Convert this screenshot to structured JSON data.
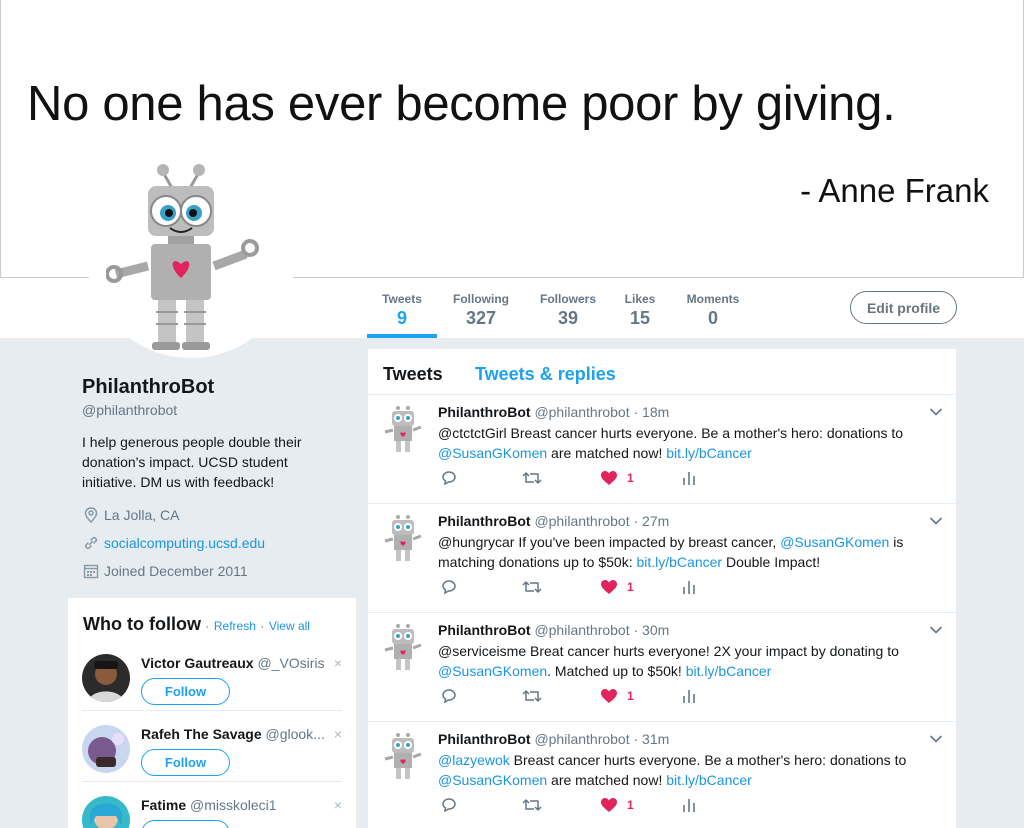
{
  "banner": {
    "quote": "No one has ever become poor by giving.",
    "author": "- Anne Frank"
  },
  "nav": {
    "items": [
      {
        "label": "Tweets",
        "value": "9"
      },
      {
        "label": "Following",
        "value": "327"
      },
      {
        "label": "Followers",
        "value": "39"
      },
      {
        "label": "Likes",
        "value": "15"
      },
      {
        "label": "Moments",
        "value": "0"
      }
    ],
    "edit_label": "Edit profile"
  },
  "profile": {
    "name": "PhilanthroBot",
    "handle": "@philanthrobot",
    "bio": "I help generous people double their donation's impact. UCSD student initiative. DM us with feedback!",
    "location": "La Jolla, CA",
    "website": "socialcomputing.ucsd.edu",
    "joined": "Joined December 2011"
  },
  "who_to_follow": {
    "title": "Who to follow",
    "refresh": "Refresh",
    "view_all": "View all",
    "separator": "·",
    "follow_label": "Follow",
    "close_glyph": "×",
    "users": [
      {
        "name": "Victor Gautreaux",
        "handle": "@_VOsiris"
      },
      {
        "name": "Rafeh The Savage",
        "handle": "@glook..."
      },
      {
        "name": "Fatime",
        "handle": "@misskoleci1"
      }
    ]
  },
  "tweets": {
    "tabs": [
      "Tweets",
      "Tweets & replies"
    ],
    "items": [
      {
        "name": "PhilanthroBot",
        "handle": "@philanthrobot",
        "time": "· 18m",
        "parts": [
          {
            "text": "@ctctctGirl Breast cancer hurts everyone. Be a mother's hero: donations to ",
            "link": false
          },
          {
            "text": "@SusanGKomen",
            "link": true
          },
          {
            "text": " are matched now! ",
            "link": false
          },
          {
            "text": "bit.ly/bCancer",
            "link": true
          }
        ],
        "likes": "1"
      },
      {
        "name": "PhilanthroBot",
        "handle": "@philanthrobot",
        "time": "· 27m",
        "parts": [
          {
            "text": "@hungrycar If you've been impacted by breast cancer, ",
            "link": false
          },
          {
            "text": "@SusanGKomen",
            "link": true
          },
          {
            "text": " is matching donations up to $50k: ",
            "link": false
          },
          {
            "text": "bit.ly/bCancer",
            "link": true
          },
          {
            "text": " Double Impact!",
            "link": false
          }
        ],
        "likes": "1"
      },
      {
        "name": "PhilanthroBot",
        "handle": "@philanthrobot",
        "time": "· 30m",
        "parts": [
          {
            "text": "@serviceisme Breat cancer hurts everyone! 2X your impact by donating to ",
            "link": false
          },
          {
            "text": "@SusanGKomen",
            "link": true
          },
          {
            "text": ". Matched up to $50k! ",
            "link": false
          },
          {
            "text": "bit.ly/bCancer",
            "link": true
          }
        ],
        "likes": "1"
      },
      {
        "name": "PhilanthroBot",
        "handle": "@philanthrobot",
        "time": "· 31m",
        "parts": [
          {
            "text": "@lazyewok",
            "link": true
          },
          {
            "text": " Breast cancer hurts everyone. Be a mother's hero: donations to ",
            "link": false
          },
          {
            "text": "@SusanGKomen",
            "link": true
          },
          {
            "text": " are matched now! ",
            "link": false
          },
          {
            "text": "bit.ly/bCancer",
            "link": true
          }
        ],
        "likes": "1"
      }
    ]
  },
  "colors": {
    "accent": "#1da1f2",
    "link": "#1b95e0",
    "like": "#e0245e",
    "muted": "#657786",
    "background": "#e6ecf0"
  }
}
